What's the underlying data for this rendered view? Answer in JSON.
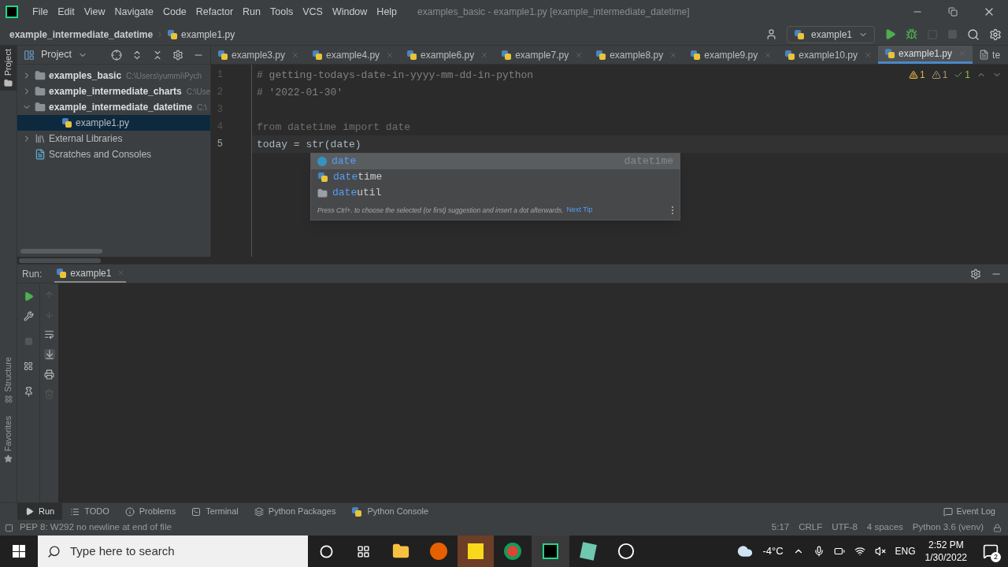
{
  "menu": [
    "File",
    "Edit",
    "View",
    "Navigate",
    "Code",
    "Refactor",
    "Run",
    "Tools",
    "VCS",
    "Window",
    "Help"
  ],
  "window": {
    "title": "examples_basic - example1.py [example_intermediate_datetime]"
  },
  "breadcrumb": [
    "example_intermediate_datetime",
    "example1.py"
  ],
  "run_config": {
    "label": "example1"
  },
  "side_stripe": {
    "top": "Project",
    "bottom": [
      "Structure",
      "Favorites"
    ]
  },
  "project_panel": {
    "title": "Project"
  },
  "tree": [
    {
      "name": "examples_basic",
      "path": "C:\\Users\\yummi\\Pych",
      "kind": "folder",
      "expanded": false,
      "selected": false
    },
    {
      "name": "example_intermediate_charts",
      "path": "C:\\Use",
      "kind": "folder",
      "expanded": false,
      "selected": false
    },
    {
      "name": "example_intermediate_datetime",
      "path": "C:\\",
      "kind": "folder",
      "expanded": true,
      "selected": false,
      "children": [
        {
          "name": "example1.py",
          "kind": "python",
          "selected": true
        }
      ]
    },
    {
      "name": "External Libraries",
      "kind": "libraries",
      "expanded": false,
      "selected": false
    },
    {
      "name": "Scratches and Consoles",
      "kind": "scratches",
      "selected": false
    }
  ],
  "tabs": [
    {
      "label": "example3.py",
      "selected": false
    },
    {
      "label": "example4.py",
      "selected": false
    },
    {
      "label": "example6.py",
      "selected": false
    },
    {
      "label": "example7.py",
      "selected": false
    },
    {
      "label": "example8.py",
      "selected": false
    },
    {
      "label": "example9.py",
      "selected": false
    },
    {
      "label": "example10.py",
      "selected": false
    },
    {
      "label": "example1.py",
      "selected": true
    },
    {
      "label": "te",
      "selected": false,
      "kind": "text"
    }
  ],
  "inspections": [
    {
      "kind": "warning",
      "count": "1"
    },
    {
      "kind": "weak",
      "count": "1"
    },
    {
      "kind": "typo",
      "count": "1"
    }
  ],
  "code_lines": [
    {
      "number": "1",
      "text": "# getting-todays-date-in-yyyy-mm-dd-in-python",
      "kind": "comment",
      "current": false
    },
    {
      "number": "2",
      "text": "# '2022-01-30'",
      "kind": "comment",
      "current": false
    },
    {
      "number": "3",
      "current": false
    },
    {
      "number": "4",
      "text": "from datetime import date",
      "kind": "unused",
      "current": false
    },
    {
      "number": "5",
      "text": "today = str(date)",
      "kind": "plain",
      "current": true
    }
  ],
  "completion": {
    "items": [
      {
        "match": "date",
        "type_hint": "datetime",
        "kind": "class",
        "selected": true
      },
      {
        "match": "date",
        "rest": "time",
        "kind": "module",
        "selected": false
      },
      {
        "match": "date",
        "rest": "util",
        "kind": "package",
        "selected": false
      }
    ],
    "hint": "Press Ctrl+. to choose the selected (or first) suggestion and insert a dot afterwards.",
    "next_tip": "Next Tip"
  },
  "run_panel": {
    "label": "Run:",
    "tab": "example1"
  },
  "tool_tabs": [
    {
      "label": "Run",
      "kind": "run",
      "selected": true
    },
    {
      "label": "TODO",
      "kind": "todo",
      "selected": false
    },
    {
      "label": "Problems",
      "kind": "problems",
      "selected": false
    },
    {
      "label": "Terminal",
      "kind": "terminal",
      "selected": false
    },
    {
      "label": "Python Packages",
      "kind": "packages",
      "selected": false
    },
    {
      "label": "Python Console",
      "kind": "console",
      "selected": false
    }
  ],
  "event_log": "Event Log",
  "status_bar": {
    "message": "PEP 8: W292 no newline at end of file",
    "items": [
      "5:17",
      "CRLF",
      "UTF-8",
      "4 spaces",
      "Python 3.6 (venv)"
    ]
  },
  "taskbar": {
    "search_placeholder": "Type here to search",
    "temperature": "-4°C",
    "language": "ENG",
    "time": "2:52 PM",
    "date": "1/30/2022",
    "notifications": "2"
  }
}
